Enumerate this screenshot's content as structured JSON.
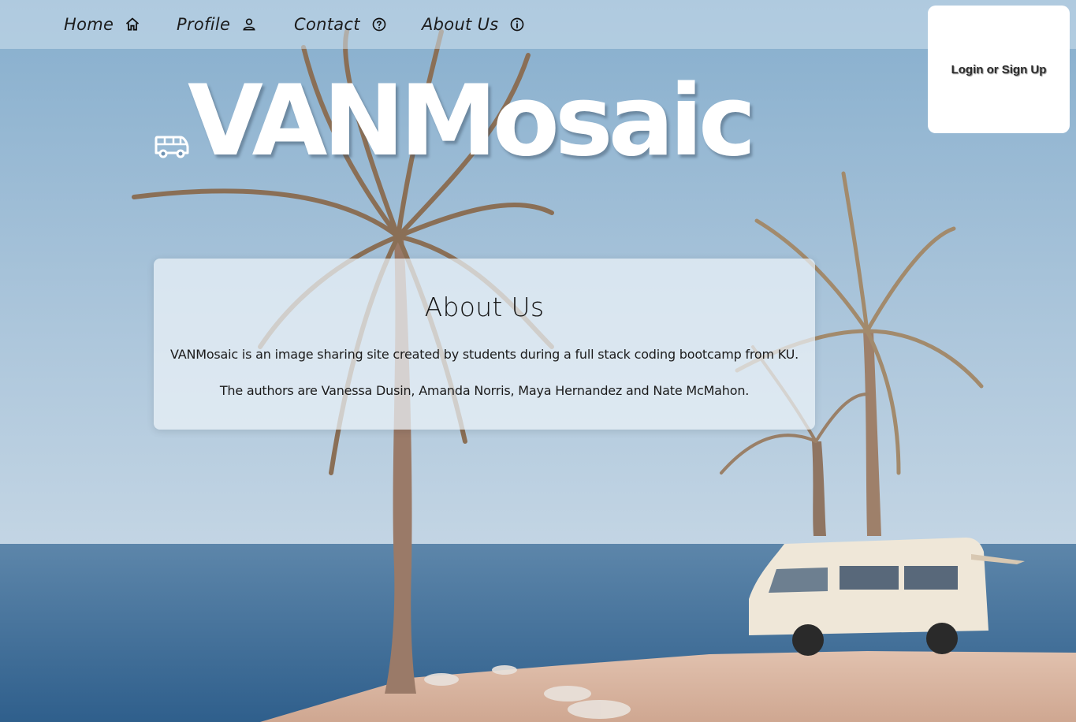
{
  "nav": {
    "items": [
      {
        "label": "Home",
        "icon": "home-icon"
      },
      {
        "label": "Profile",
        "icon": "user-icon"
      },
      {
        "label": "Contact",
        "icon": "question-icon"
      },
      {
        "label": "About Us",
        "icon": "info-icon"
      }
    ]
  },
  "auth": {
    "login_label": "Login or Sign Up"
  },
  "logo": {
    "text": "VANMosaic",
    "icon": "van-icon"
  },
  "about": {
    "title": "About Us",
    "paragraphs": [
      "VANMosaic is an image sharing site created by students during a full stack coding bootcamp from KU.",
      "The authors are Vanessa Dusin, Amanda Norris, Maya Hernandez and Nate McMahon."
    ]
  },
  "colors": {
    "sky_top": "#8fb3cf",
    "sky_bottom": "#b9cfe0",
    "sea": "#3f6f99",
    "sand": "#d9b7a4",
    "nav_bg": "#d2e2ee",
    "card_bg": "#ecf2f8",
    "logo_text": "#ffffff"
  }
}
